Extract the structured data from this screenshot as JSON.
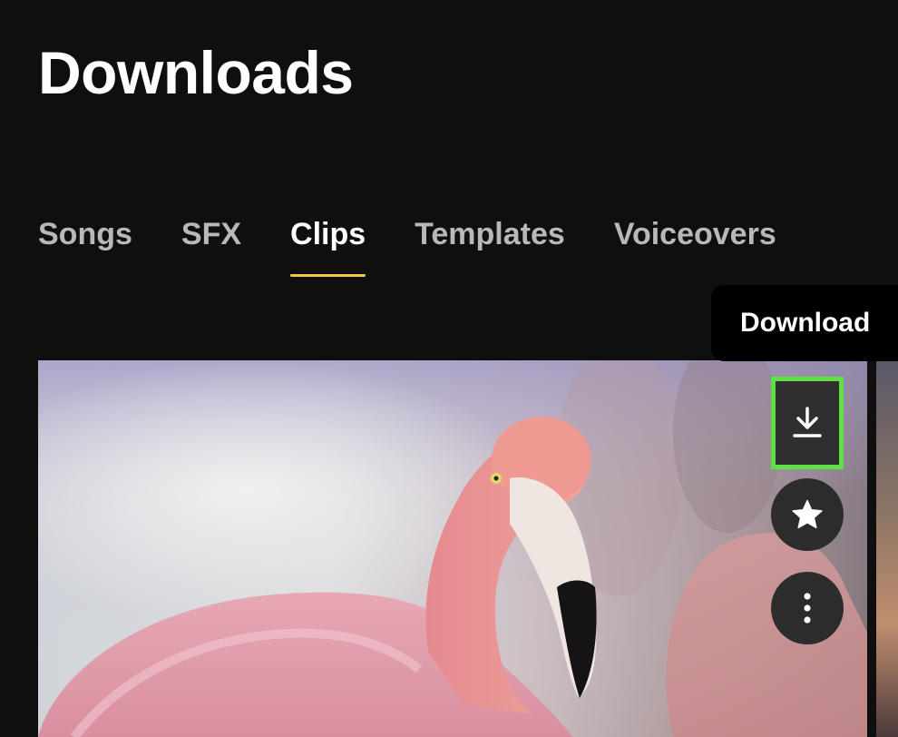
{
  "page": {
    "title": "Downloads"
  },
  "tabs": [
    {
      "label": "Songs",
      "active": false
    },
    {
      "label": "SFX",
      "active": false
    },
    {
      "label": "Clips",
      "active": true
    },
    {
      "label": "Templates",
      "active": false
    },
    {
      "label": "Voiceovers",
      "active": false
    }
  ],
  "tooltip": {
    "text": "Download"
  },
  "clip": {
    "actions": [
      {
        "name": "download",
        "icon": "download-icon",
        "highlighted": true
      },
      {
        "name": "favorite",
        "icon": "star-icon",
        "highlighted": false
      },
      {
        "name": "more",
        "icon": "more-vertical-icon",
        "highlighted": false
      }
    ]
  },
  "colors": {
    "background": "#0f0f0f",
    "active_tab_underline": "#f2c84b",
    "highlight_border": "#5fe044",
    "action_button_bg": "#2c2c2c"
  }
}
